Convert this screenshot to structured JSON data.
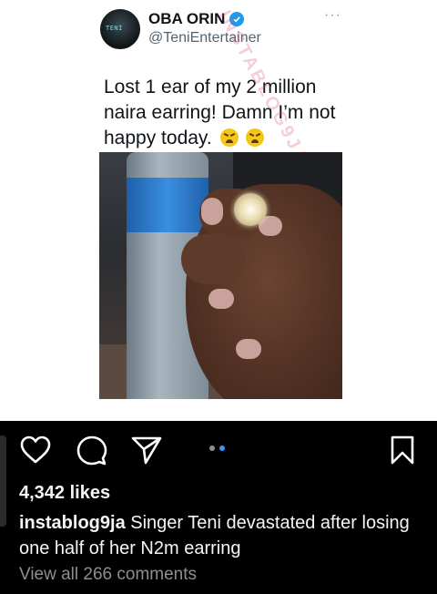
{
  "tweet": {
    "display_name": "OBA ORIN",
    "handle": "@TeniEntertainer",
    "more": "···",
    "text": "Lost 1 ear of my 2 million naira earring! Damn I’m not happy today.",
    "watermark": "INSTABLOG9JA"
  },
  "post": {
    "likes": "4,342 likes",
    "username": "instablog9ja",
    "caption": "Singer Teni devastated after losing one half of her N2m earring",
    "view_comments": "View all 266 comments"
  },
  "colors": {
    "verified": "#1d9bf0",
    "carousel_active": "#3897f0"
  },
  "icons": [
    "heart-icon",
    "comment-icon",
    "share-icon",
    "bookmark-icon",
    "verified-badge-icon"
  ]
}
